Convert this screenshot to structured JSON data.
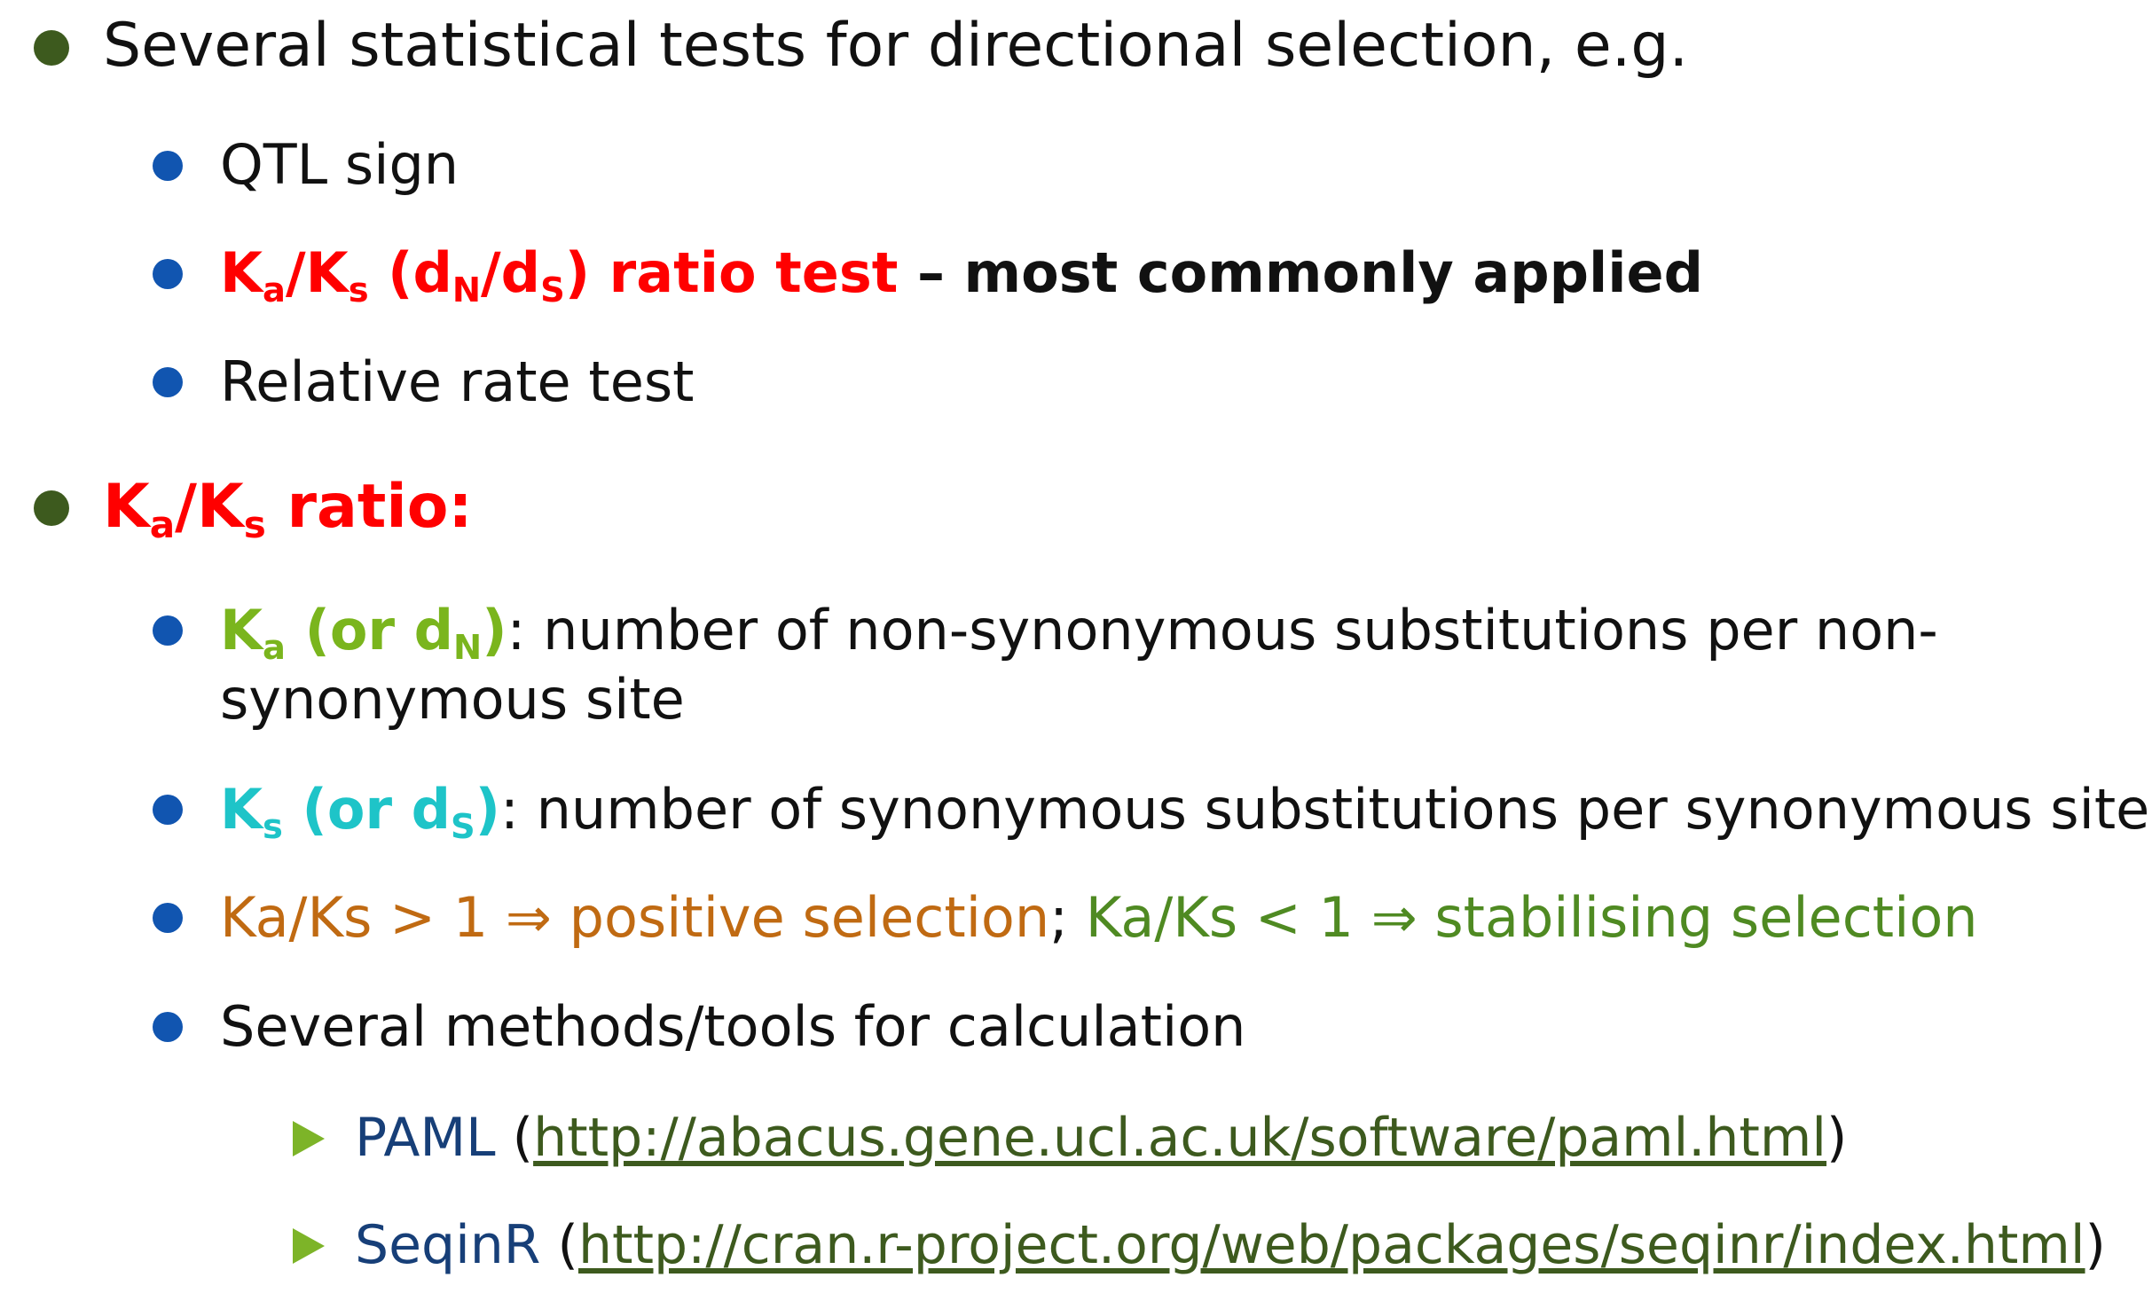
{
  "bullets": {
    "intro": "Several statistical tests for directional selection, e.g.",
    "qtl": "QTL sign",
    "kaks_test": {
      "k1": "K",
      "k1_sub": "a",
      "slash1": "/",
      "k2": "K",
      "k2_sub": "s",
      "paren_open": " (d",
      "d1_sub": "N",
      "slash2": "/d",
      "d2_sub": "S",
      "rest": ") ratio test",
      "suffix": " – most commonly applied"
    },
    "relative": "Relative rate test",
    "ratio_heading": {
      "k1": "K",
      "k1_sub": "a",
      "slash": "/",
      "k2": "K",
      "k2_sub": "s",
      "rest": " ratio:"
    },
    "ka_def": {
      "k": "K",
      "k_sub": "a",
      "or": " (or d",
      "d_sub": "N",
      "close": ")",
      "text_line1": ": number of non-synonymous substitutions per non-",
      "text_line2": "synonymous site"
    },
    "ks_def": {
      "k": "K",
      "k_sub": "s",
      "or": " (or d",
      "d_sub": "S",
      "close": ")",
      "text": ": number of synonymous substitutions per synonymous site"
    },
    "interpret": {
      "positive": "Ka/Ks > 1 ⇒ positive selection",
      "sep": "; ",
      "stabilising": "Ka/Ks < 1 ⇒ stabilising selection"
    },
    "methods": "Several methods/tools for calculation",
    "tools": [
      {
        "name": "PAML",
        "open": " (",
        "url": "http://abacus.gene.ucl.ac.uk/software/paml.html",
        "close": ")"
      },
      {
        "name": "SeqinR",
        "open": " (",
        "url": "http://cran.r-project.org/web/packages/seqinr/index.html",
        "close": ")"
      }
    ]
  },
  "colors": {
    "level1_bullet": "#3d5a1e",
    "level2_bullet": "#1155b0",
    "level3_arrow": "#7db428",
    "red": "#ff0000",
    "ka_green": "#7ab51d",
    "ks_cyan": "#1ec4c8",
    "positive_orange": "#c06a12",
    "stabilising_green": "#4f8a22",
    "tool_name_navy": "#173f78",
    "link_green": "#3d5a1e"
  },
  "icons": [
    "level1-bullet-icon",
    "level2-bullet-icon",
    "level3-arrow-icon"
  ]
}
